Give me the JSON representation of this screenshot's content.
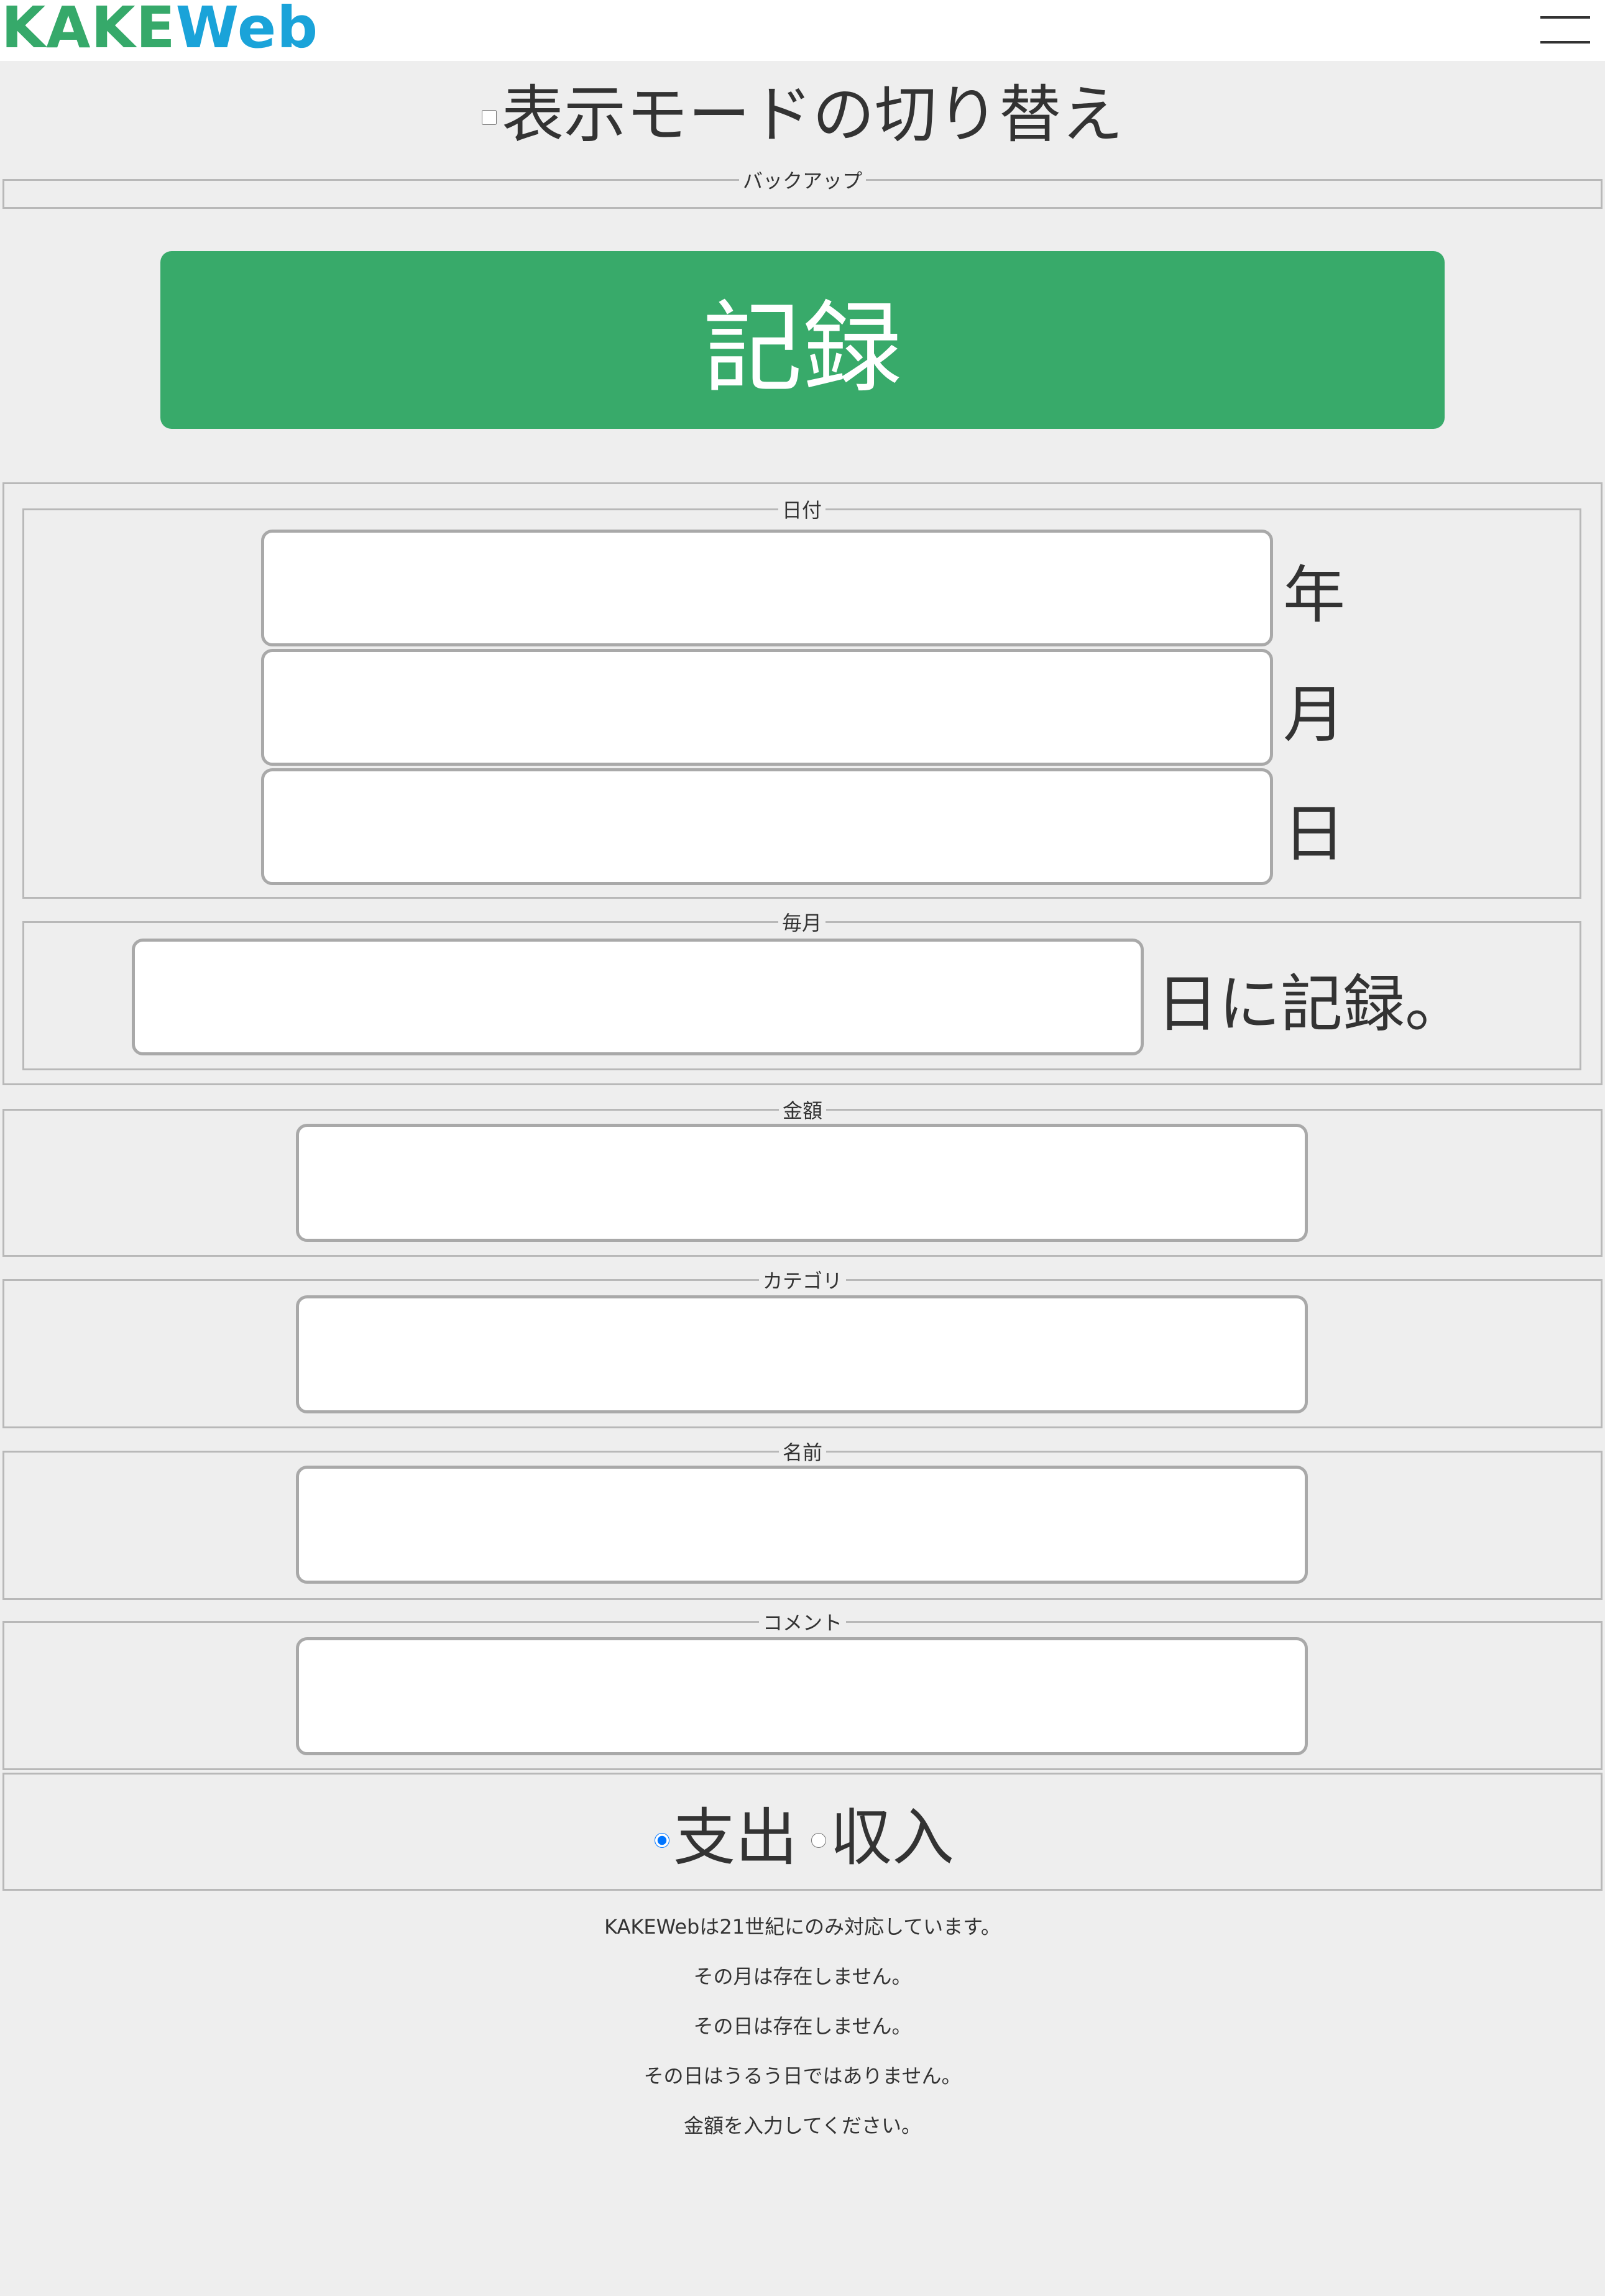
{
  "header": {
    "logo_part1": "KAKE",
    "logo_part2": "Web",
    "menu_icon": "hamburger-menu-icon"
  },
  "mode_toggle": {
    "label": "表示モードの切り替え",
    "checked": false
  },
  "backup": {
    "legend": "バックアップ"
  },
  "record_button": {
    "label": "記録"
  },
  "date": {
    "legend": "日付",
    "year_suffix": "年",
    "month_suffix": "月",
    "day_suffix": "日",
    "year_value": "",
    "month_value": "",
    "day_value": ""
  },
  "monthly": {
    "legend": "毎月",
    "suffix": "日に記録。",
    "value": ""
  },
  "amount": {
    "legend": "金額",
    "value": ""
  },
  "category": {
    "legend": "カテゴリ",
    "value": ""
  },
  "name": {
    "legend": "名前",
    "value": ""
  },
  "comment": {
    "legend": "コメント",
    "value": ""
  },
  "type": {
    "expense_label": "支出",
    "income_label": "収入",
    "selected": "expense"
  },
  "messages": [
    "KAKEWebは21世紀にのみ対応しています。",
    "その月は存在しません。",
    "その日は存在しません。",
    "その日はうるう日ではありません。",
    "金額を入力してください。"
  ],
  "colors": {
    "logo_green": "#36a96a",
    "logo_blue": "#1aa3d9",
    "record_button": "#38aa6a",
    "background": "#eeeeee"
  }
}
